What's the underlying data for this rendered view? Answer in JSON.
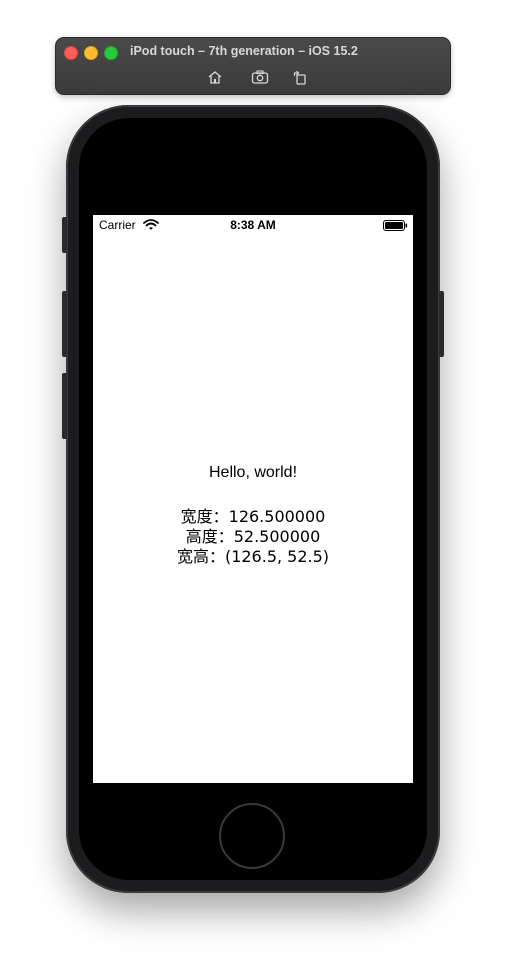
{
  "window": {
    "title": "iPod touch – 7th generation – iOS 15.2",
    "toolbar": [
      {
        "name": "home-icon"
      },
      {
        "name": "screenshot-icon"
      },
      {
        "name": "rotate-icon"
      }
    ]
  },
  "status_bar": {
    "carrier": "Carrier",
    "time": "8:38 AM",
    "wifi_icon": "wifi-icon",
    "battery_icon": "battery-icon"
  },
  "content": {
    "hello": "Hello, world!",
    "width_line": "宽度：126.500000",
    "height_line": "高度：52.500000",
    "size_line": "宽高：(126.5, 52.5)"
  },
  "colors": {
    "close": "#ff5f57",
    "minimize": "#febc2e",
    "zoom": "#28c840",
    "titlebar": "#3b3b3b",
    "device": "#1c1c1e"
  }
}
